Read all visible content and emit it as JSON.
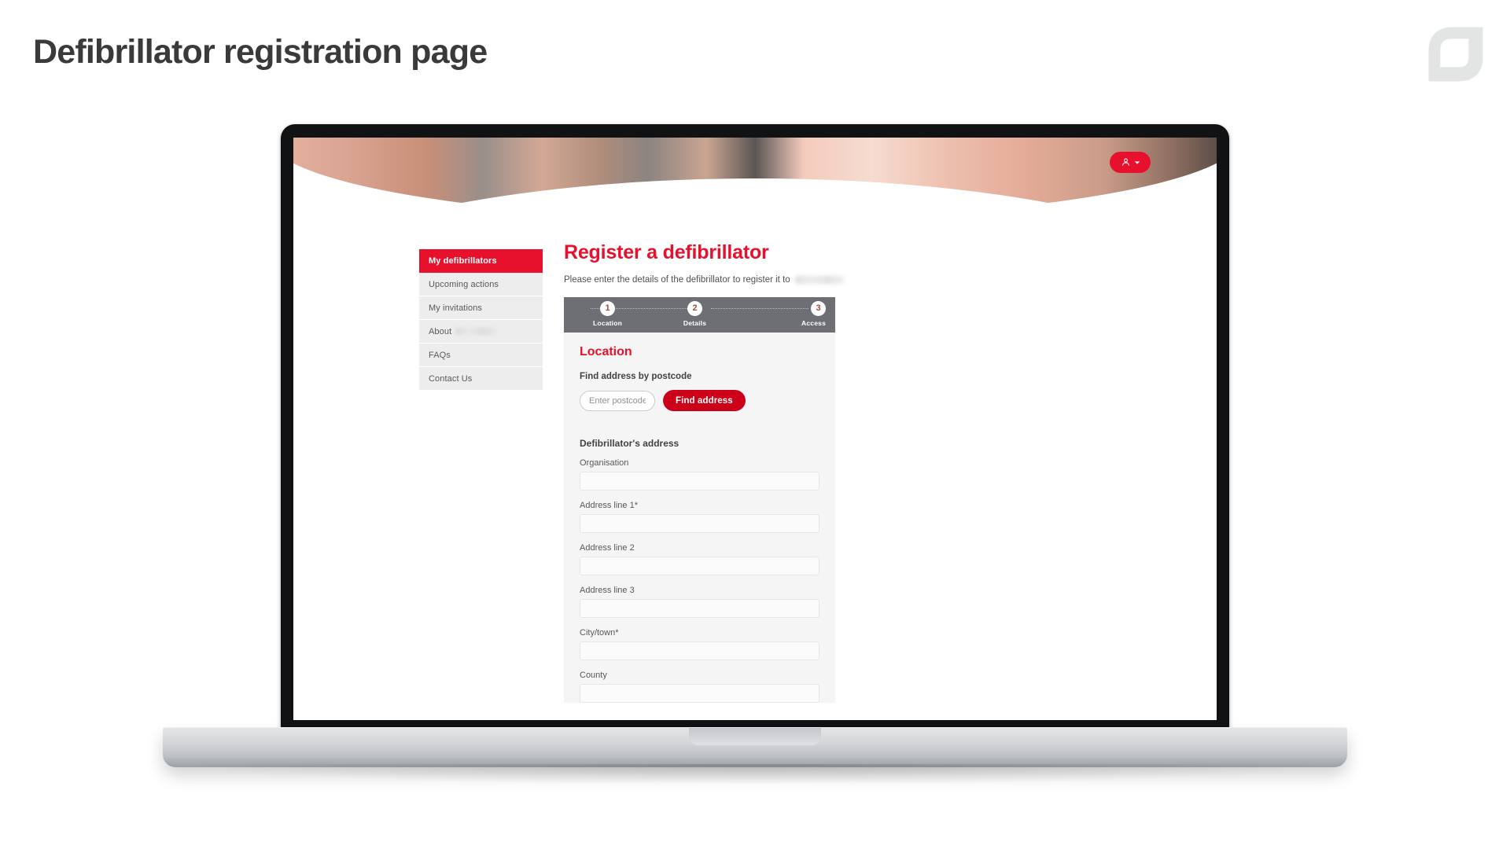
{
  "slide": {
    "title": "Defibrillator registration page",
    "logo_icon": "leaf-logo-icon"
  },
  "browser": {
    "account_button": {
      "person_icon": "person-icon",
      "chevron_icon": "chevron-down-icon"
    }
  },
  "sidebar": {
    "items": [
      {
        "label": "My defibrillators",
        "active": true,
        "redacted": false
      },
      {
        "label": "Upcoming actions",
        "active": false,
        "redacted": false
      },
      {
        "label": "My invitations",
        "active": false,
        "redacted": false
      },
      {
        "label": "About",
        "active": false,
        "redacted": true
      },
      {
        "label": "FAQs",
        "active": false,
        "redacted": false
      },
      {
        "label": "Contact Us",
        "active": false,
        "redacted": false
      }
    ]
  },
  "main": {
    "title": "Register a defibrillator",
    "subtitle": "Please enter the details of the defibrillator to register it to",
    "subtitle_redacted": true
  },
  "stepper": {
    "steps": [
      {
        "number": "1",
        "label": "Location",
        "current": true
      },
      {
        "number": "2",
        "label": "Details",
        "current": false
      },
      {
        "number": "3",
        "label": "Access",
        "current": false
      }
    ]
  },
  "form": {
    "section_title": "Location",
    "postcode_lookup": {
      "heading": "Find address by postcode",
      "input_value": "",
      "input_placeholder": "Enter postcode",
      "button_label": "Find address"
    },
    "address_section_title": "Defibrillator's address",
    "fields": [
      {
        "label": "Organisation",
        "value": "",
        "required": false
      },
      {
        "label": "Address line 1*",
        "value": "",
        "required": true
      },
      {
        "label": "Address line 2",
        "value": "",
        "required": false
      },
      {
        "label": "Address line 3",
        "value": "",
        "required": false
      },
      {
        "label": "City/town*",
        "value": "",
        "required": true
      },
      {
        "label": "County",
        "value": "",
        "required": false
      }
    ]
  },
  "colors": {
    "brand_red": "#E8112D",
    "button_red": "#CC0018",
    "stepper_gray": "#6D6F75",
    "card_bg": "#F5F5F5",
    "nav_bg": "#EDEDED",
    "title_dark": "#3A3A3A"
  }
}
